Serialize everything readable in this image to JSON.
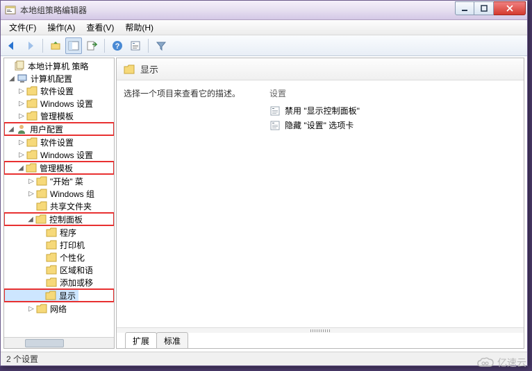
{
  "window": {
    "title": "本地组策略编辑器"
  },
  "menu": {
    "file": "文件(F)",
    "action": "操作(A)",
    "view": "查看(V)",
    "help": "帮助(H)"
  },
  "tree": {
    "root": "本地计算机 策略",
    "computer_config": "计算机配置",
    "cc_software": "软件设置",
    "cc_windows": "Windows 设置",
    "cc_admin": "管理模板",
    "user_config": "用户配置",
    "uc_software": "软件设置",
    "uc_windows": "Windows 设置",
    "uc_admin": "管理模板",
    "start_menu": "\"开始\" 菜",
    "windows_components": "Windows 组",
    "shared_folders": "共享文件夹",
    "control_panel": "控制面板",
    "cp_programs": "程序",
    "cp_printers": "打印机",
    "cp_personalization": "个性化",
    "cp_region": "区域和语",
    "cp_addremove": "添加或移",
    "cp_display": "显示",
    "cp_network": "网络"
  },
  "details": {
    "heading": "显示",
    "prompt": "选择一个项目来查看它的描述。",
    "column_header": "设置",
    "items": [
      "禁用 \"显示控制面板\"",
      "隐藏 \"设置\" 选项卡"
    ],
    "tab_extended": "扩展",
    "tab_standard": "标准"
  },
  "status": {
    "text": "2 个设置"
  },
  "watermark": {
    "text": "亿速云"
  }
}
